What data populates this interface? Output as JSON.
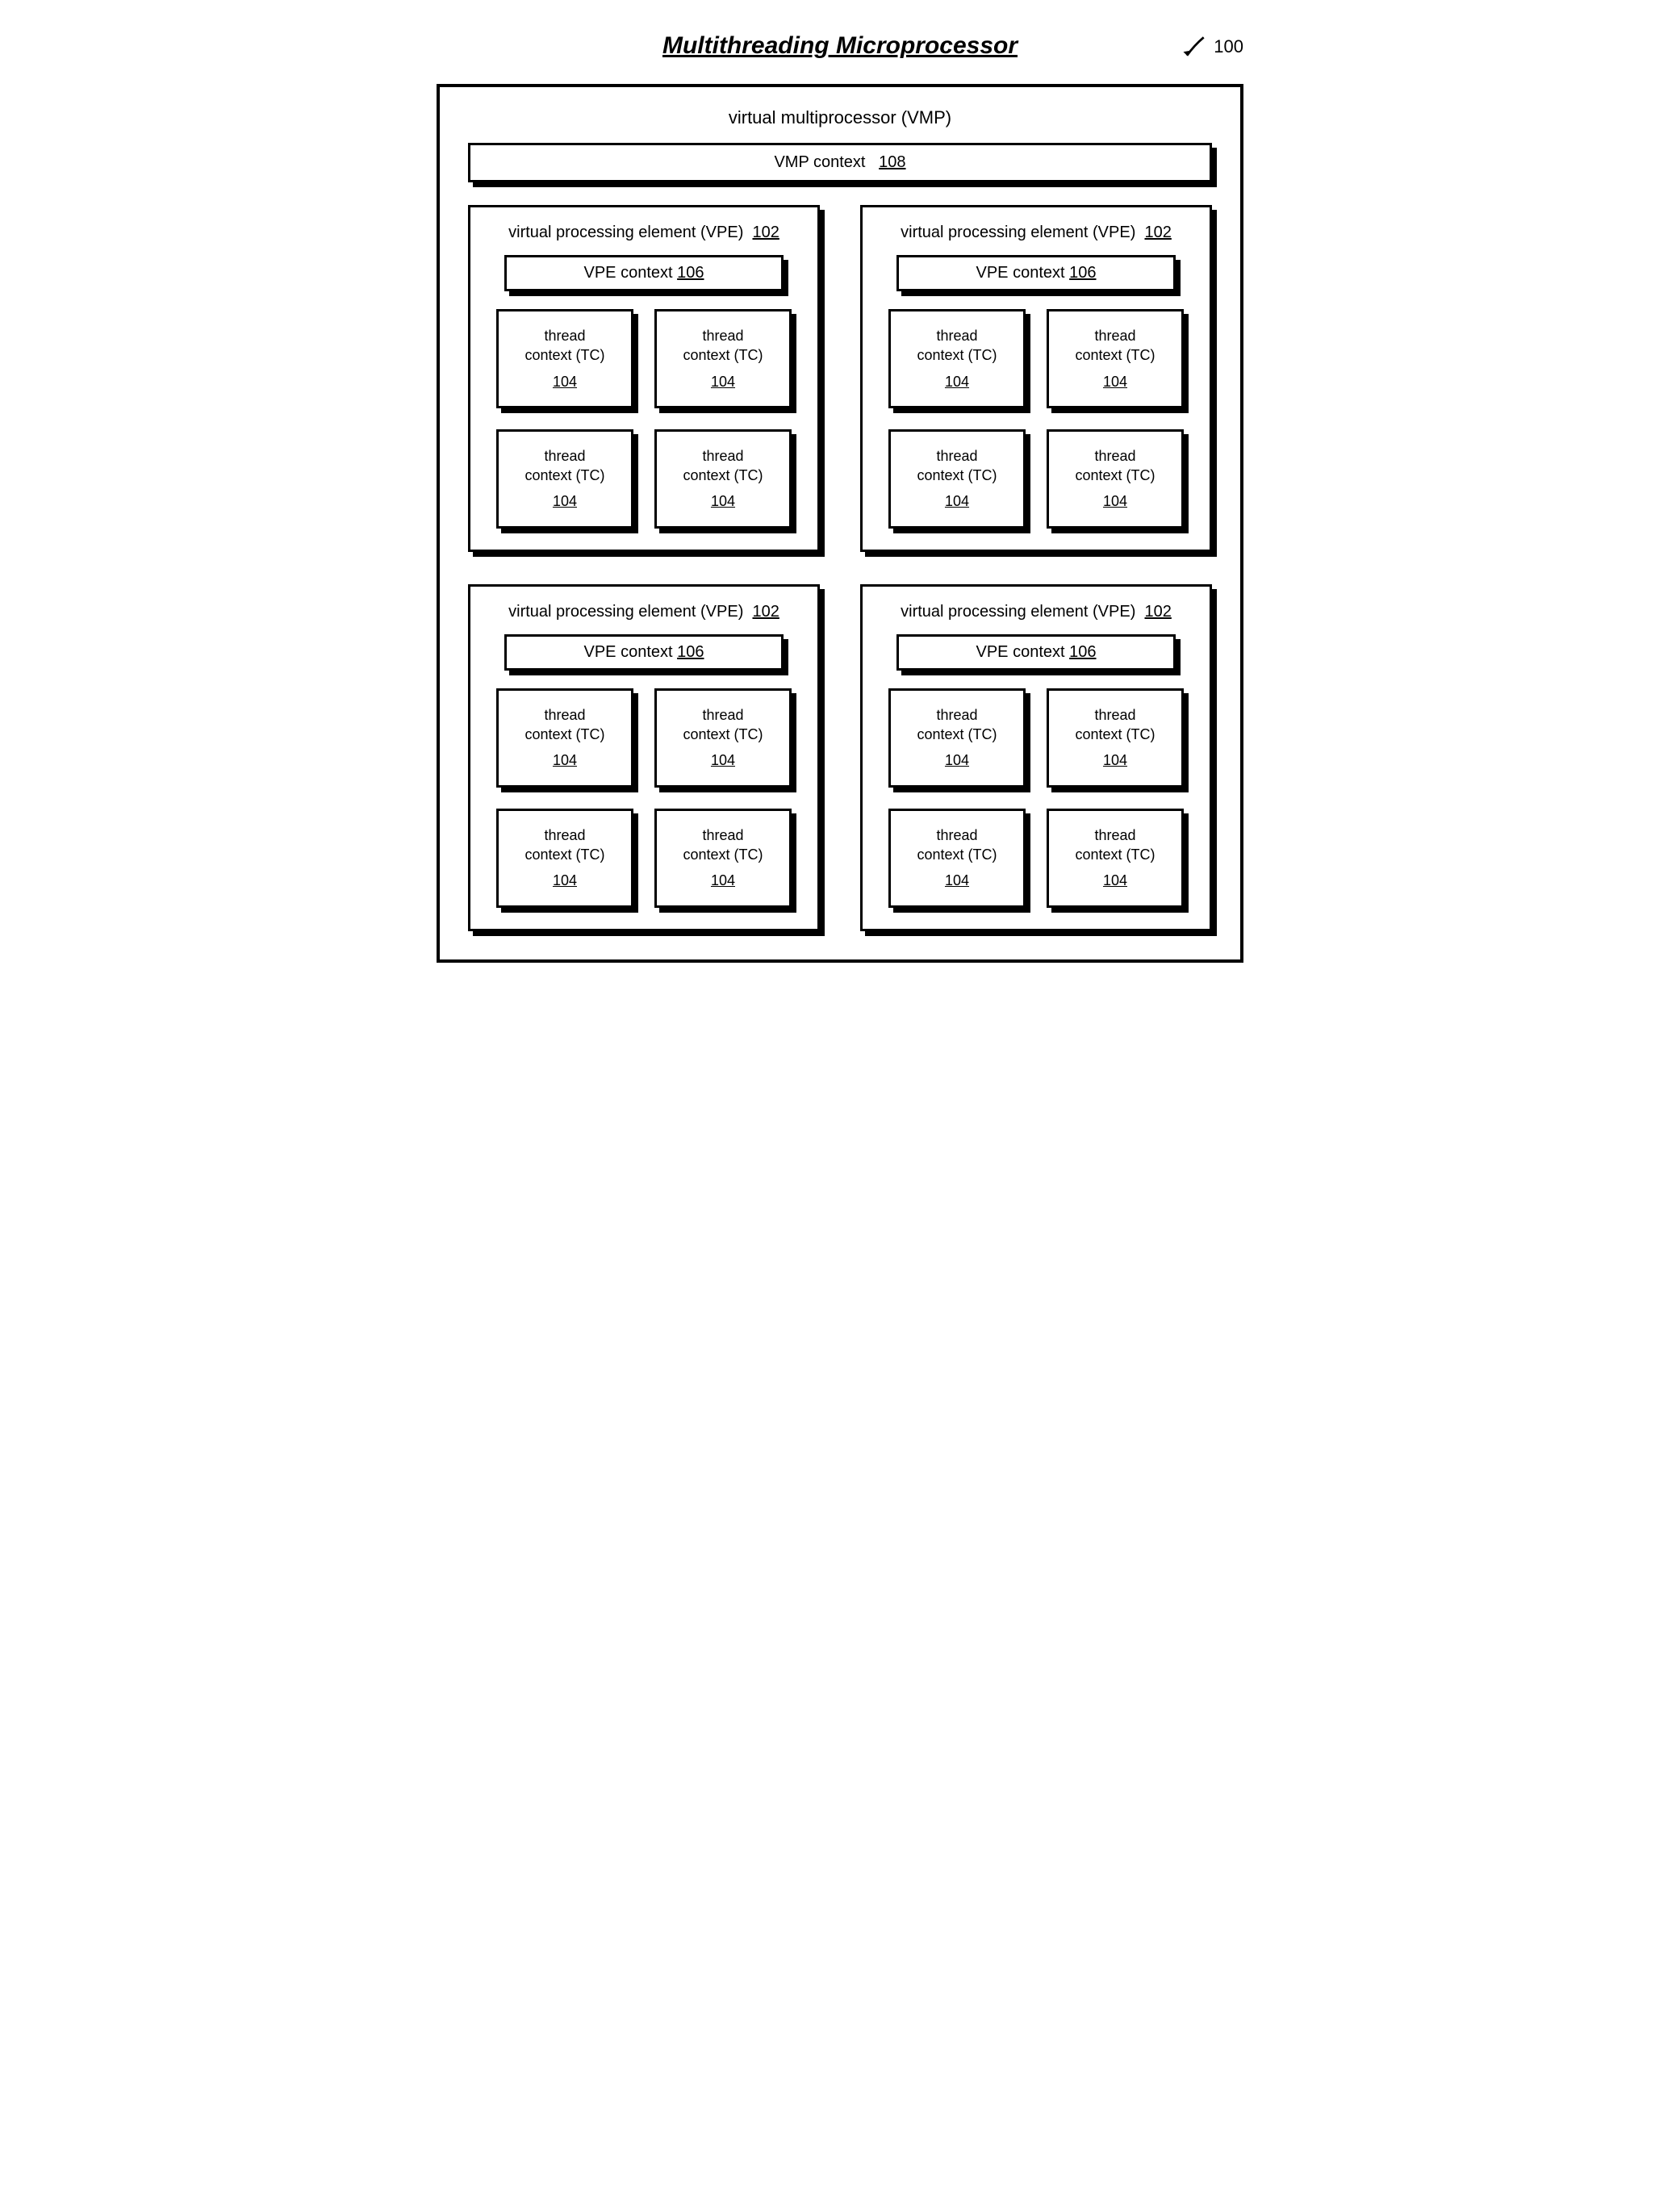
{
  "title": "Multithreading Microprocessor",
  "ref_main": "100",
  "vmp": {
    "label": "virtual multiprocessor (VMP)",
    "context_label": "VMP context",
    "context_ref": "108"
  },
  "vpe": {
    "label_prefix": "virtual processing element (VPE)",
    "ref": "102",
    "context_label": "VPE context",
    "context_ref": "106"
  },
  "tc": {
    "line1": "thread",
    "line2": "context (TC)",
    "ref": "104"
  },
  "counts": {
    "vpes": 4,
    "tcs_per_vpe": 4
  }
}
